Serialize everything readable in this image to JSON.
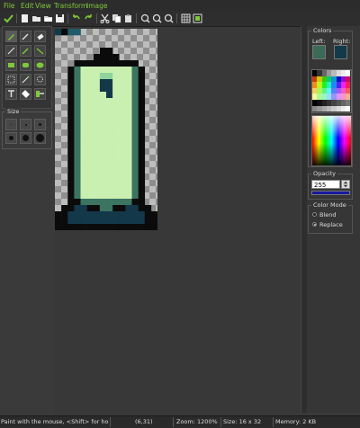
{
  "menu": [
    {
      "label": "File"
    },
    {
      "label": "Edit"
    },
    {
      "label": "View"
    },
    {
      "label": "Transform"
    },
    {
      "label": "Image"
    }
  ],
  "toolbar": {
    "buttons": [
      "apply-icon",
      "new-file-icon",
      "open-file-icon",
      "open-folder-icon",
      "save-icon",
      "undo-icon",
      "redo-icon",
      "cut-icon",
      "copy-icon",
      "paste-icon",
      "zoom-in-icon",
      "zoom-out-icon",
      "zoom-reset-icon",
      "grid-icon",
      "preview-icon"
    ]
  },
  "tools": [
    "pencil-icon",
    "brush-icon",
    "eraser-icon",
    "line-icon",
    "airbrush-icon",
    "gradient-icon",
    "rect-icon",
    "filled-rect-icon",
    "ellipse-icon",
    "select-rect-icon",
    "magic-wand-icon",
    "lasso-icon",
    "text-icon",
    "fill-icon",
    "color-picker-icon"
  ],
  "size": {
    "label": "Size",
    "options": [
      "1",
      "2",
      "3",
      "4",
      "5",
      "6"
    ]
  },
  "colors": {
    "label": "Colors",
    "left_label": "Left:",
    "right_label": "Right:",
    "left_color": "#3a6b58",
    "right_color": "#123a4a"
  },
  "opacity": {
    "label": "Opacity",
    "value": "255",
    "bar_fill": 1.0,
    "bar_color": "#1a1aa0"
  },
  "color_mode": {
    "label": "Color Mode",
    "options": [
      {
        "label": "Blend",
        "selected": false
      },
      {
        "label": "Replace",
        "selected": true
      }
    ]
  },
  "status": {
    "hint": "Paint with the mouse, <Shift> for hor/vert",
    "coords": "(6,31)",
    "zoom": "Zoom: 1200%",
    "size": "Size: 16 x 32",
    "memory": "Memory: 2 KB"
  },
  "sprite": {
    "palette": {
      ".": "transparent",
      "K": "#0b0b0b",
      "G": "#3b7561",
      "L": "#c9f0b0",
      "B": "#13384a",
      "M": "#8fd49a",
      "T": "#1f5b6a"
    },
    "rows": [
      "BKTT............",
      "................",
      "................",
      ".......KK.......",
      "......KKKK......",
      "...KKKKKKKKKK...",
      "..KGLLLLLLLLGK..",
      "..KGLLLMMLLLGK..",
      "..KGLLLBBLLLGK..",
      "..KGLLLBBLLLGK..",
      "..KGLLLLBLLLGK..",
      "..KGLLLLLLLLGK..",
      "..KGLLLLLLLLGK..",
      "..KGLLLLLLLLGK..",
      "..KGLLLLLLLLGK..",
      "..KGLLLLLLLLGK..",
      "..KGLLLLLLLLGK..",
      "..KGLLLLLLLLGK..",
      "..KGLLLLLLLLGK..",
      "..KGLLLLLLLLGK..",
      "..KGLLLLLLLLGK..",
      "..KGLLLLLLLLGK..",
      "..KGLLLLLLLLGK..",
      "..KGLLLLLLLLGK..",
      "..KGLLLLLLLLGK..",
      "..KGLLLLLLLLGK..",
      "..KGLLLLLLLLGK..",
      "..KKGGGGGGGGKK..",
      ".KKBBKKGGKKBBKK.",
      "KKBBBBBBBBBBBBKK",
      "KKBBBBBBBBBBBBKK",
      "KKKKKKKKKKKKKKKK"
    ]
  }
}
